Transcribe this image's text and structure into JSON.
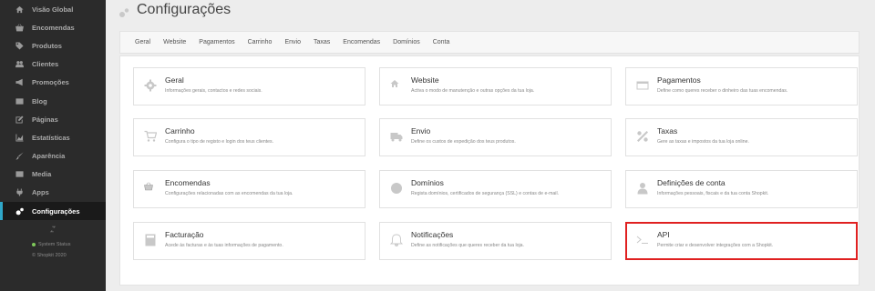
{
  "sidebar": {
    "items": [
      {
        "label": "Visão Global",
        "icon": "home-icon",
        "active": false
      },
      {
        "label": "Encomendas",
        "icon": "basket-icon",
        "active": false
      },
      {
        "label": "Produtos",
        "icon": "tag-icon",
        "active": false
      },
      {
        "label": "Clientes",
        "icon": "users-icon",
        "active": false
      },
      {
        "label": "Promoções",
        "icon": "megaphone-icon",
        "active": false
      },
      {
        "label": "Blog",
        "icon": "newspaper-icon",
        "active": false
      },
      {
        "label": "Páginas",
        "icon": "edit-icon",
        "active": false
      },
      {
        "label": "Estatísticas",
        "icon": "chart-icon",
        "active": false
      },
      {
        "label": "Aparência",
        "icon": "brush-icon",
        "active": false
      },
      {
        "label": "Media",
        "icon": "image-icon",
        "active": false
      },
      {
        "label": "Apps",
        "icon": "plug-icon",
        "active": false
      },
      {
        "label": "Configurações",
        "icon": "cogs-icon",
        "active": true
      }
    ],
    "status_label": "System Status",
    "status_color": "#7ec95a",
    "copyright": "© Shopkit 2020",
    "accent": "#2fa7c9"
  },
  "header": {
    "title": "Configurações"
  },
  "tabs": [
    "Geral",
    "Website",
    "Pagamentos",
    "Carrinho",
    "Envio",
    "Taxas",
    "Encomendas",
    "Domínios",
    "Conta"
  ],
  "cards": [
    {
      "title": "Geral",
      "desc": "Informações gerais, contactos e redes sociais.",
      "icon": "gear-icon"
    },
    {
      "title": "Website",
      "desc": "Activa o modo de manutenção e outras opções da tua loja.",
      "icon": "home-icon"
    },
    {
      "title": "Pagamentos",
      "desc": "Define como queres receber o dinheiro das tuas encomendas.",
      "icon": "credit-card-icon"
    },
    {
      "title": "Carrinho",
      "desc": "Configura o tipo de registo e login dos teus clientes.",
      "icon": "cart-icon"
    },
    {
      "title": "Envio",
      "desc": "Define os custos de expedição dos teus produtos.",
      "icon": "truck-icon"
    },
    {
      "title": "Taxas",
      "desc": "Gere as taxas e impostos da tua loja online.",
      "icon": "percent-icon"
    },
    {
      "title": "Encomendas",
      "desc": "Configurações relacionadas com as encomendas da tua loja.",
      "icon": "basket-icon"
    },
    {
      "title": "Domínios",
      "desc": "Regista domínios, certificados de segurança (SSL) e contas de e-mail.",
      "icon": "globe-icon"
    },
    {
      "title": "Definições de conta",
      "desc": "Informações pessoais, fiscais e da tua conta Shopkit.",
      "icon": "user-icon"
    },
    {
      "title": "Facturação",
      "desc": "Acede às facturas e às tuas informações de pagamento.",
      "icon": "calculator-icon"
    },
    {
      "title": "Notificações",
      "desc": "Define as notificações que queres receber da tua loja.",
      "icon": "bell-icon"
    },
    {
      "title": "API",
      "desc": "Permite criar e desenvolver integrações com a Shopkit.",
      "icon": "terminal-icon",
      "highlight": true,
      "highlight_color": "#e02020"
    }
  ]
}
